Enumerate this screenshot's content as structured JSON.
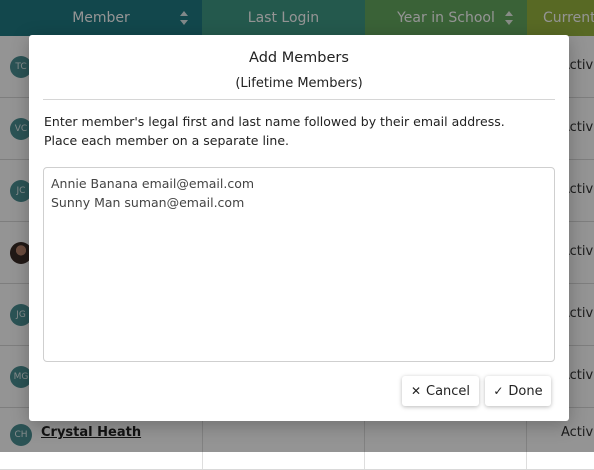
{
  "table": {
    "headers": {
      "member": "Member",
      "last_login": "Last Login",
      "year_in_school": "Year in School",
      "current": "Current"
    },
    "rows": [
      {
        "initials": "TC",
        "status": "Active"
      },
      {
        "initials": "VC",
        "status": "Active"
      },
      {
        "initials": "JC",
        "status": "Active"
      },
      {
        "initials": "",
        "status": "Active"
      },
      {
        "initials": "JG",
        "status": "Active"
      },
      {
        "initials": "MG",
        "status": "Active"
      },
      {
        "initials": "CH",
        "name": "Crystal Heath",
        "status": "Active"
      }
    ]
  },
  "modal": {
    "title": "Add Members",
    "subtitle": "(Lifetime Members)",
    "instruction_line1": "Enter member's legal first and last name followed by their email address.",
    "instruction_line2": "Place each member on a separate line.",
    "textarea_lines": [
      "Annie Banana email@email.com",
      "Sunny Man suman@email.com"
    ],
    "cancel_label": "Cancel",
    "done_label": "Done",
    "cancel_icon": "close-icon",
    "done_icon": "check-icon"
  }
}
